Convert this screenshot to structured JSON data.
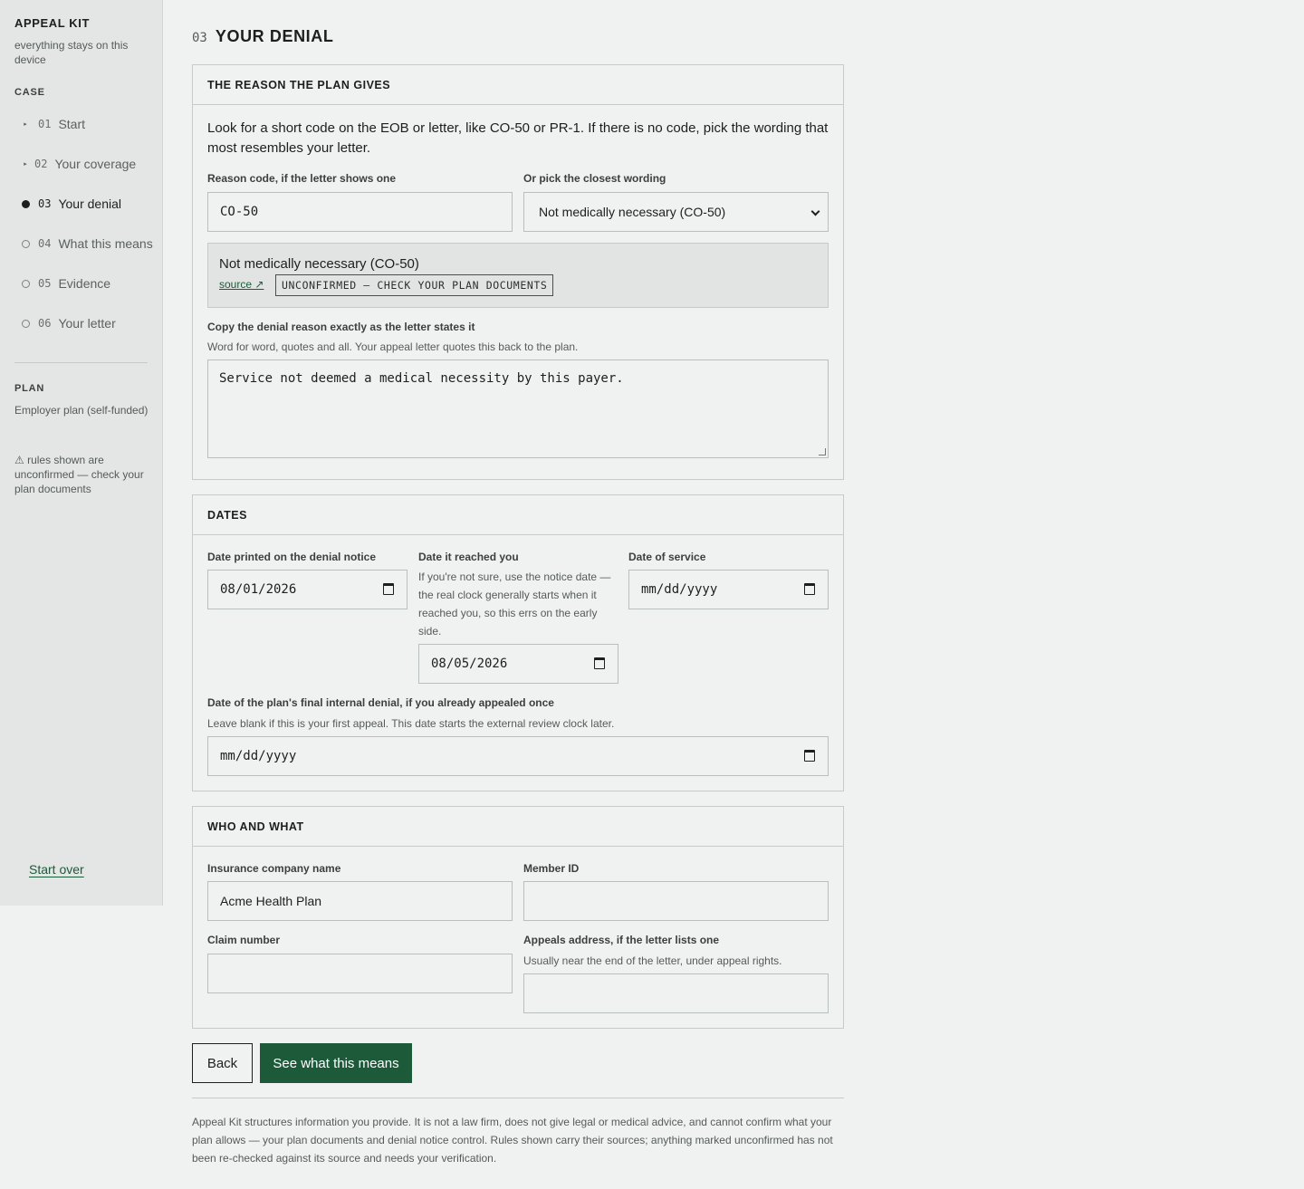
{
  "sidebar": {
    "brand": "APPEAL KIT",
    "tagline": "everything stays on this device",
    "case_label": "CASE",
    "steps": [
      {
        "num": "01",
        "label": "Start"
      },
      {
        "num": "02",
        "label": "Your coverage"
      },
      {
        "num": "03",
        "label": "Your denial"
      },
      {
        "num": "04",
        "label": "What this means"
      },
      {
        "num": "05",
        "label": "Evidence"
      },
      {
        "num": "06",
        "label": "Your letter"
      }
    ],
    "plan_label": "PLAN",
    "plan_value": "Employer plan (self-funded)",
    "warning": "⚠ rules shown are unconfirmed — check your plan documents",
    "start_over": "Start over"
  },
  "header": {
    "step_num": "03",
    "title": "YOUR DENIAL"
  },
  "reason": {
    "heading": "THE REASON THE PLAN GIVES",
    "intro": "Look for a short code on the EOB or letter, like CO-50 or PR-1. If there is no code, pick the wording that most resembles your letter.",
    "code_label": "Reason code, if the letter shows one",
    "code_value": "CO-50",
    "wording_label": "Or pick the closest wording",
    "wording_value": "Not medically necessary (CO-50)",
    "callout_title": "Not medically necessary (CO-50)",
    "source_link": "source ↗",
    "badge": "UNCONFIRMED — CHECK YOUR PLAN DOCUMENTS",
    "copy_label": "Copy the denial reason exactly as the letter states it",
    "copy_hint": "Word for word, quotes and all. Your appeal letter quotes this back to the plan.",
    "copy_value": "Service not deemed a medical necessity by this payer."
  },
  "dates": {
    "heading": "DATES",
    "printed_label": "Date printed on the denial notice",
    "printed_value": "08/01/2026",
    "reached_label": "Date it reached you",
    "reached_hint": "If you're not sure, use the notice date — the real clock generally starts when it reached you, so this errs on the early side.",
    "reached_value": "08/05/2026",
    "service_label": "Date of service",
    "service_value": "mm/dd/yyyy",
    "final_label": "Date of the plan's final internal denial, if you already appealed once",
    "final_hint": "Leave blank if this is your first appeal. This date starts the external review clock later.",
    "final_value": "mm/dd/yyyy"
  },
  "who": {
    "heading": "WHO AND WHAT",
    "insurer_label": "Insurance company name",
    "insurer_value": "Acme Health Plan",
    "member_label": "Member ID",
    "member_value": "",
    "claim_label": "Claim number",
    "claim_value": "",
    "address_label": "Appeals address, if the letter lists one",
    "address_hint": "Usually near the end of the letter, under appeal rights.",
    "address_value": ""
  },
  "actions": {
    "back": "Back",
    "next": "See what this means"
  },
  "footer": "Appeal Kit structures information you provide. It is not a law firm, does not give legal or medical advice, and cannot confirm what your plan allows — your plan documents and denial notice control. Rules shown carry their sources; anything marked unconfirmed has not been re-checked against its source and needs your verification."
}
